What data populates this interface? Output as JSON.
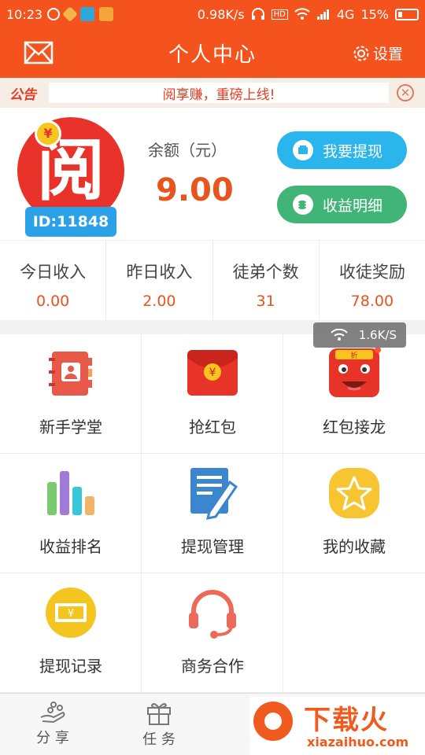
{
  "status_bar": {
    "time": "10:23",
    "network_speed": "0.98K/s",
    "network_type": "4G",
    "battery": "15%",
    "hd_label": "HD"
  },
  "header": {
    "title": "个人中心",
    "settings_label": "设置"
  },
  "notice": {
    "tag": "公告",
    "text": "阅享赚，重磅上线!"
  },
  "profile": {
    "avatar_char": "阅",
    "coin_char": "¥",
    "user_id": "ID:11848",
    "balance_label": "余额（元）",
    "balance_value": "9.00",
    "withdraw_button": "我要提现",
    "earnings_button": "收益明细"
  },
  "stats": [
    {
      "label": "今日收入",
      "value": "0.00"
    },
    {
      "label": "昨日收入",
      "value": "2.00"
    },
    {
      "label": "徒弟个数",
      "value": "31"
    },
    {
      "label": "收徒奖励",
      "value": "78.00"
    }
  ],
  "grid": [
    {
      "label": "新手学堂",
      "icon": "contacts-book-icon"
    },
    {
      "label": "抢红包",
      "icon": "red-envelope-icon"
    },
    {
      "label": "红包接龙",
      "icon": "red-envelope-dragon-icon"
    },
    {
      "label": "收益排名",
      "icon": "bar-ranking-icon"
    },
    {
      "label": "提现管理",
      "icon": "note-pen-icon"
    },
    {
      "label": "我的收藏",
      "icon": "star-icon"
    },
    {
      "label": "提现记录",
      "icon": "money-note-icon"
    },
    {
      "label": "商务合作",
      "icon": "headset-icon"
    }
  ],
  "speed_toast": "1.6K/S",
  "bottom_nav": [
    {
      "label": "分 享",
      "icon": "share-hand-icon"
    },
    {
      "label": "任 务",
      "icon": "gift-icon"
    }
  ],
  "watermark": {
    "title": "下载火",
    "subtitle": "xiazaihuo.com"
  },
  "colors": {
    "brand": "#f5531d",
    "accent_text": "#e8541e",
    "withdraw_blue": "#2bb5ed",
    "detail_green": "#40b577"
  }
}
